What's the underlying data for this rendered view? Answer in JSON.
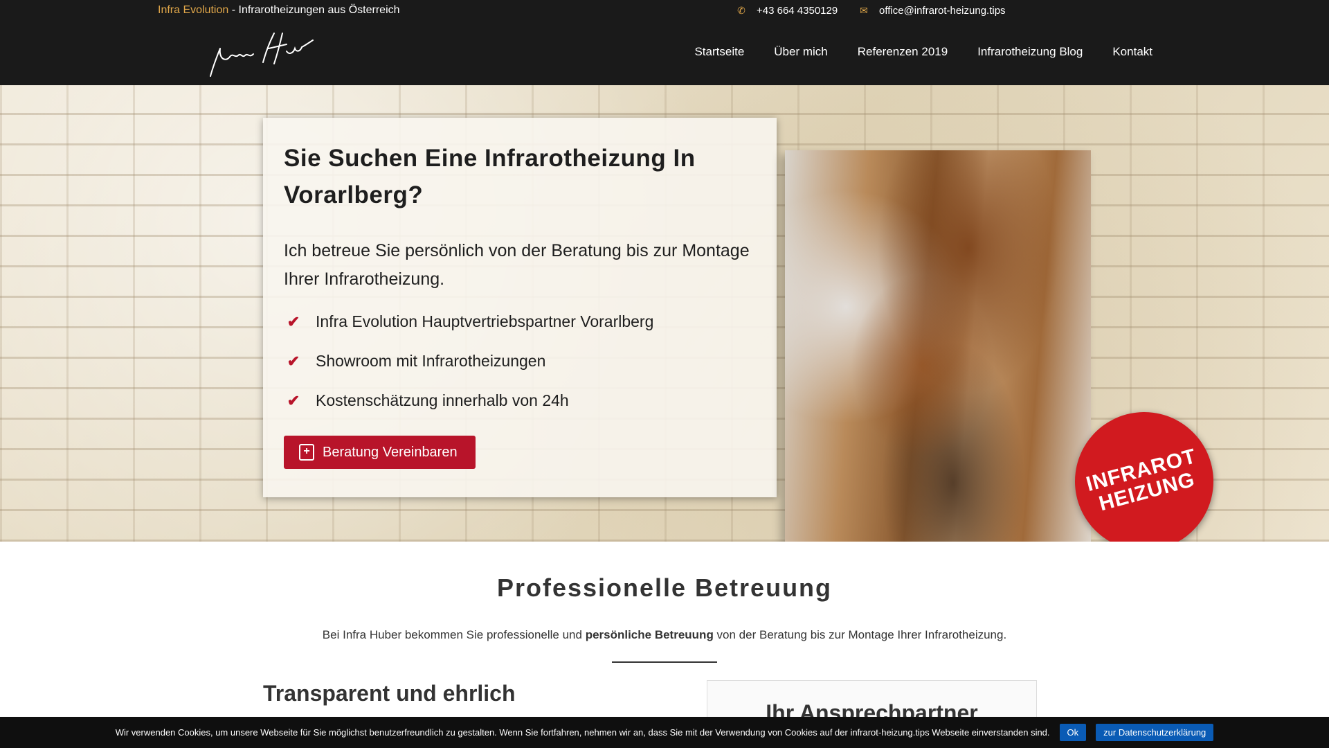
{
  "topbar": {
    "brand": "Infra Evolution",
    "tagline": " - Infrarotheizungen aus Österreich",
    "phone_icon": "phone-icon",
    "phone": "+43 664 4350129",
    "mail_icon": "envelope-icon",
    "email": "office@infrarot-heizung.tips"
  },
  "logo": {
    "alt": "Infra Huber",
    "text": "Infra Huber"
  },
  "nav": {
    "items": [
      {
        "label": "Startseite"
      },
      {
        "label": "Über mich"
      },
      {
        "label": "Referenzen 2019"
      },
      {
        "label": "Infrarotheizung Blog"
      },
      {
        "label": "Kontakt"
      }
    ]
  },
  "hero": {
    "title": "Sie Suchen Eine Infrarotheizung In Vorarlberg?",
    "lead": "Ich betreue Sie persönlich von der Beratung bis zur Montage Ihrer Infrarotheizung.",
    "bullets": [
      "Infra Evolution Hauptvertriebspartner Vorarlberg",
      "Showroom mit Infrarotheizungen",
      "Kostenschätzung innerhalb von 24h"
    ],
    "cta_label": "Beratung Vereinbaren",
    "badge_line1": "INFRAROT",
    "badge_line2": "HEIZUNG"
  },
  "section": {
    "title": "Professionelle Betreuung",
    "text_before": "Bei Infra Huber bekommen Sie professionelle und ",
    "text_bold": "persönliche Betreuung",
    "text_after": " von der Beratung bis zur Montage Ihrer Infrarotheizung.",
    "col_heading": "Transparent und ehrlich",
    "contact_heading": "Ihr Ansprechpartner"
  },
  "cookie": {
    "text": "Wir verwenden Cookies, um unsere Webseite für Sie möglichst benutzerfreundlich zu gestalten. Wenn Sie fortfahren, nehmen wir an, dass Sie mit der Verwendung von Cookies auf der infrarot-heizung.tips Webseite einverstanden sind.",
    "ok_label": "Ok",
    "privacy_label": "zur Datenschutzerklärung"
  },
  "colors": {
    "brand_gold": "#e2a84a",
    "accent_red": "#b8142a",
    "badge_red": "#d11a1f",
    "cookie_button_blue": "#0a5bb5"
  }
}
